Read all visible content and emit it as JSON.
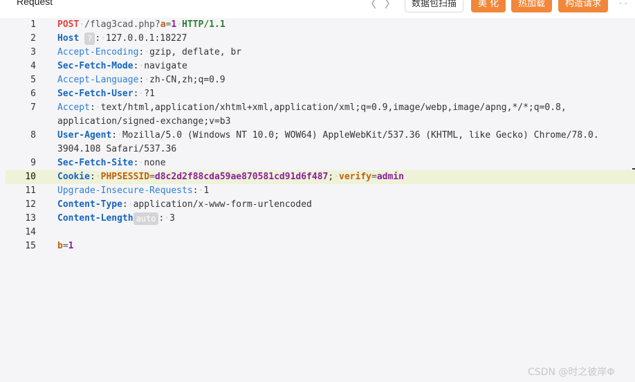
{
  "header": {
    "title": "Request",
    "nav_prev": "〈",
    "nav_next": "〉",
    "buttons": {
      "packet_scan": "数据包扫描",
      "beautify": "美 化",
      "hot_load": "热加载",
      "build_request": "构造请求"
    },
    "expand_icon": "⛶"
  },
  "editor": {
    "line_numbers": [
      "1",
      "2",
      "3",
      "4",
      "5",
      "6",
      "7",
      "8",
      "9",
      "10",
      "11",
      "12",
      "13",
      "14",
      "15"
    ],
    "active_line": "10",
    "request_line": {
      "method": "POST",
      "path": "/flag3cad.php?",
      "param_key": "a",
      "param_eq": "=",
      "param_val": "1",
      "version": "HTTP/1.1"
    },
    "headers": {
      "host": {
        "key": "Host",
        "badge": "?",
        "value": "127.0.0.1:18227"
      },
      "accept_encoding": {
        "key": "Accept-Encoding",
        "value": "gzip, deflate, br"
      },
      "sec_fetch_mode": {
        "key": "Sec-Fetch-Mode",
        "value": "navigate"
      },
      "accept_language": {
        "key": "Accept-Language",
        "value": "zh-CN,zh;q=0.9"
      },
      "sec_fetch_user": {
        "key": "Sec-Fetch-User",
        "value": "?1"
      },
      "accept": {
        "key": "Accept",
        "value": "text/html,application/xhtml+xml,application/xml;q=0.9,image/webp,image/apng,*/*;q=0.8,",
        "value2": "application/signed-exchange;v=b3"
      },
      "user_agent": {
        "key": "User-Agent",
        "value": "Mozilla/5.0 (Windows NT 10.0; WOW64) AppleWebKit/537.36 (KHTML, like Gecko) Chrome/78.0.",
        "value2": "3904.108 Safari/537.36"
      },
      "sec_fetch_site": {
        "key": "Sec-Fetch-Site",
        "value": "none"
      },
      "cookie": {
        "key": "Cookie",
        "k1": "PHPSESSID",
        "v1": "d8c2d2f88cda59ae870581cd91d6f487",
        "k2": "verify",
        "v2": "admin"
      },
      "upgrade_insecure": {
        "key": "Upgrade-Insecure-Requests",
        "value": "1"
      },
      "content_type": {
        "key": "Content-Type",
        "value": "application/x-www-form-urlencoded"
      },
      "content_length": {
        "key": "Content-Length",
        "badge": "auto",
        "value": "3"
      }
    },
    "body": {
      "key": "b",
      "value": "1"
    }
  },
  "watermark": "CSDN @时之彼岸Φ"
}
